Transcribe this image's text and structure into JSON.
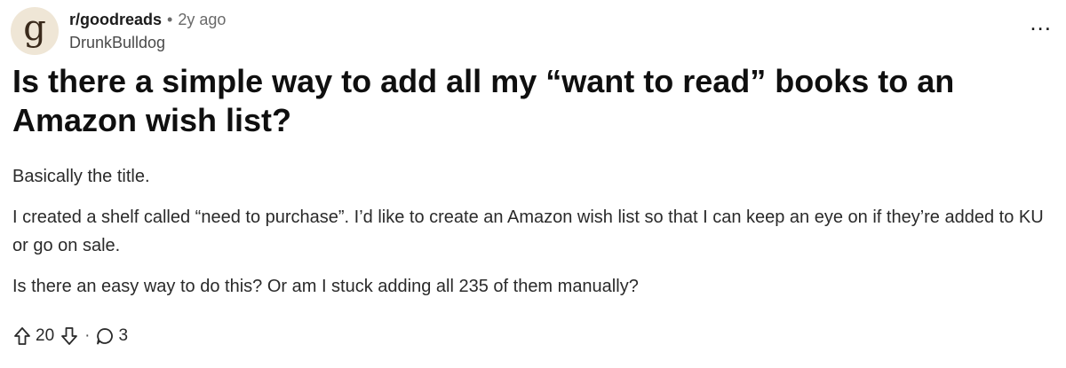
{
  "post": {
    "subreddit": "r/goodreads",
    "time_ago": "2y ago",
    "author": "DrunkBulldog",
    "avatar_letter": "g",
    "meta_separator": "•",
    "more_label": "...",
    "title": "Is there a simple way to add all my “want to read” books to an Amazon wish list?",
    "body": [
      "Basically the title.",
      "I created a shelf called “need to purchase”. I’d like to create an Amazon wish list so that I can keep an eye on if they’re added to KU or go on sale.",
      "Is there an easy way to do this? Or am I stuck adding all 235 of them manually?"
    ]
  },
  "actions": {
    "upvotes": "20",
    "separator": "·",
    "comments": "3"
  },
  "icons": {
    "avatar": "goodreads-logo-icon",
    "more": "ellipsis-icon",
    "upvote": "upvote-arrow-icon",
    "downvote": "downvote-arrow-icon",
    "comment": "comment-bubble-icon"
  },
  "colors": {
    "avatar_bg": "#efe6d6",
    "muted_text": "#6a6a6a"
  }
}
